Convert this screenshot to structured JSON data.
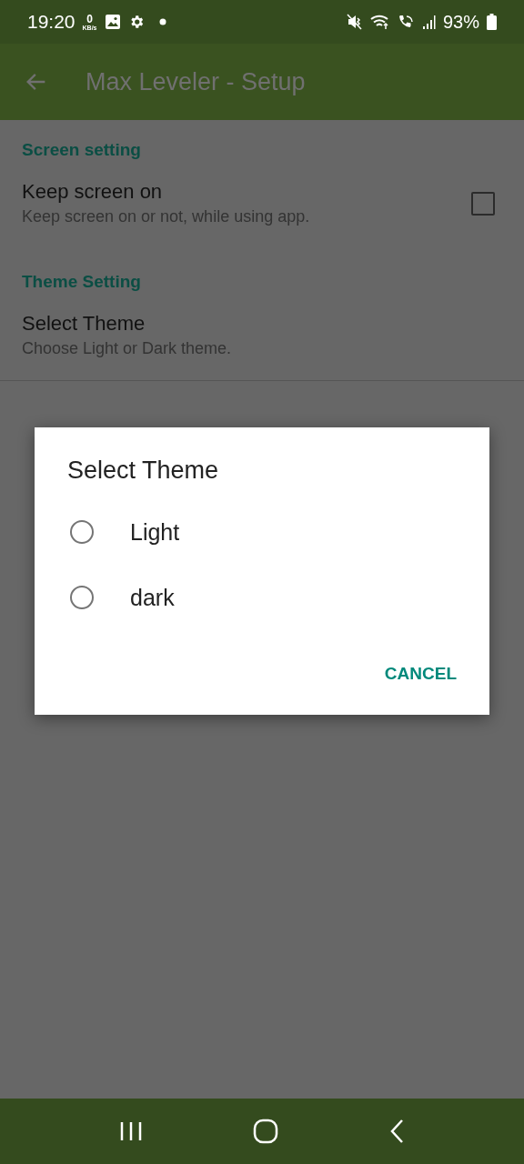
{
  "status_bar": {
    "time": "19:20",
    "net_speed": "0",
    "net_unit": "KB/s",
    "battery": "93%"
  },
  "app_bar": {
    "title": "Max Leveler - Setup"
  },
  "sections": [
    {
      "header": "Screen setting",
      "items": [
        {
          "kind": "checkbox",
          "title": "Keep screen on",
          "summary": "Keep screen on or not, while using app.",
          "checked": false
        }
      ]
    },
    {
      "header": "Theme Setting",
      "items": [
        {
          "kind": "plain",
          "title": "Select Theme",
          "summary": "Choose Light or Dark theme."
        }
      ]
    }
  ],
  "dialog": {
    "title": "Select Theme",
    "options": [
      {
        "label": "Light",
        "selected": false
      },
      {
        "label": "dark",
        "selected": false
      }
    ],
    "buttons": [
      "CANCEL"
    ]
  }
}
